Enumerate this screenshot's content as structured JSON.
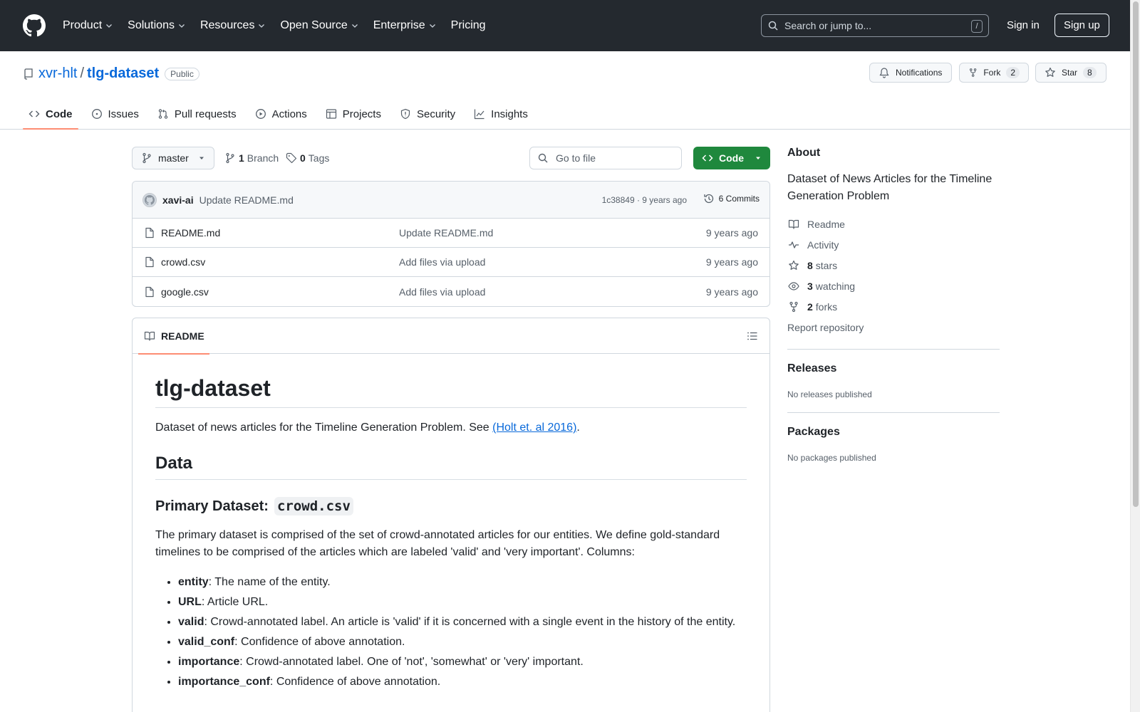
{
  "header": {
    "nav": [
      "Product",
      "Solutions",
      "Resources",
      "Open Source",
      "Enterprise",
      "Pricing"
    ],
    "search_placeholder": "Search or jump to...",
    "search_shortcut": "/",
    "signin": "Sign in",
    "signup": "Sign up"
  },
  "repo": {
    "owner": "xvr-hlt",
    "separator": "/",
    "name": "tlg-dataset",
    "visibility": "Public",
    "notifications_label": "Notifications",
    "fork_label": "Fork",
    "fork_count": "2",
    "star_label": "Star",
    "star_count": "8"
  },
  "tabs": [
    "Code",
    "Issues",
    "Pull requests",
    "Actions",
    "Projects",
    "Security",
    "Insights"
  ],
  "toolbar": {
    "branch": "master",
    "branch_count": "1",
    "branch_label": "Branch",
    "tag_count": "0",
    "tag_label": "Tags",
    "goto_placeholder": "Go to file",
    "code_label": "Code"
  },
  "commit": {
    "author": "xavi-ai",
    "message": "Update README.md",
    "meta": "1c38849 · 9 years ago",
    "commits": "6 Commits"
  },
  "files": [
    {
      "name": "README.md",
      "message": "Update README.md",
      "date": "9 years ago"
    },
    {
      "name": "crowd.csv",
      "message": "Add files via upload",
      "date": "9 years ago"
    },
    {
      "name": "google.csv",
      "message": "Add files via upload",
      "date": "9 years ago"
    }
  ],
  "readme": {
    "tab_label": "README",
    "title": "tlg-dataset",
    "intro": "Dataset of news articles for the Timeline Generation Problem. See ",
    "intro_link": "(Holt et. al 2016)",
    "intro_end": ".",
    "h_data": "Data",
    "h_primary": "Primary Dataset:",
    "h_primary_code": "crowd.csv",
    "primary_desc": "The primary dataset is comprised of the set of crowd-annotated articles for our entities. We define gold-standard timelines to be comprised of the articles which are labeled 'valid' and 'very important'. Columns:",
    "columns": [
      {
        "key": "entity",
        "desc": ": The name of the entity."
      },
      {
        "key": "URL",
        "desc": ": Article URL."
      },
      {
        "key": "valid",
        "desc": ": Crowd-annotated label. An article is 'valid' if it is concerned with a single event in the history of the entity."
      },
      {
        "key": "valid_conf",
        "desc": ": Confidence of above annotation."
      },
      {
        "key": "importance",
        "desc": ": Crowd-annotated label. One of 'not', 'somewhat' or 'very' important."
      },
      {
        "key": "importance_conf",
        "desc": ": Confidence of above annotation."
      }
    ]
  },
  "about": {
    "title": "About",
    "description": "Dataset of News Articles for the Timeline Generation Problem",
    "readme": "Readme",
    "activity": "Activity",
    "stars_count": "8",
    "stars_label": "stars",
    "watching_count": "3",
    "watching_label": "watching",
    "forks_count": "2",
    "forks_label": "forks",
    "report": "Report repository"
  },
  "releases": {
    "title": "Releases",
    "empty": "No releases published"
  },
  "packages": {
    "title": "Packages",
    "empty": "No packages published"
  },
  "colors": {
    "header_bg": "#24292f",
    "accent": "#0969da",
    "code_button": "#1f883d",
    "tab_underline": "#fd8c73"
  }
}
